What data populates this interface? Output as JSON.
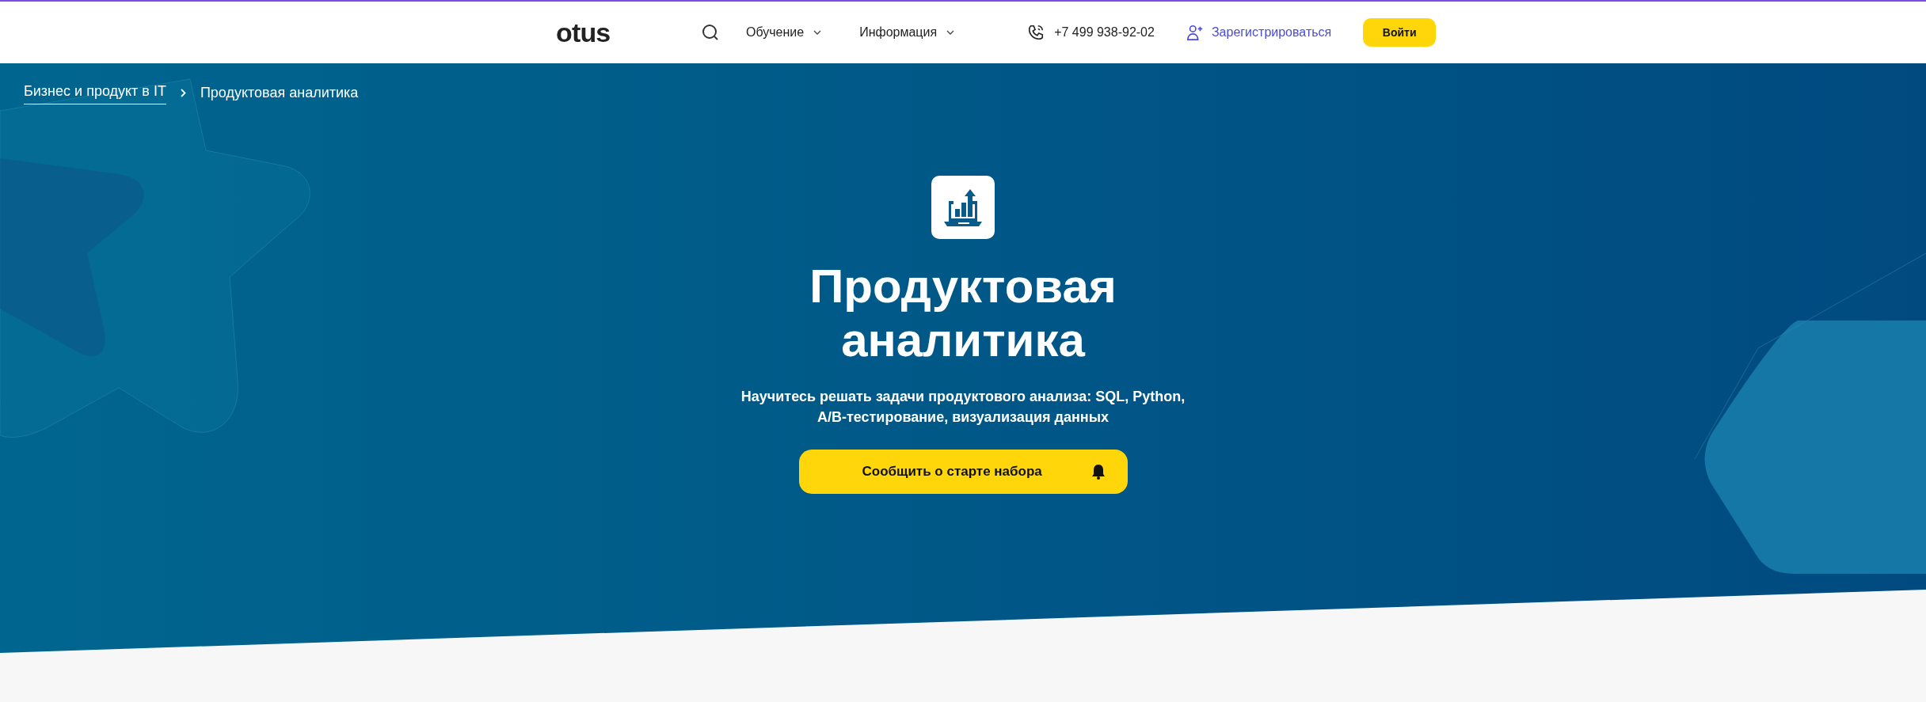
{
  "header": {
    "logo": "otus",
    "nav": [
      {
        "label": "Обучение"
      },
      {
        "label": "Информация"
      }
    ],
    "phone": "+7 499 938-92-02",
    "register": "Зарегистрироваться",
    "login": "Войти"
  },
  "breadcrumbs": [
    {
      "label": "Бизнес и продукт в IT",
      "link": true
    },
    {
      "label": "Продуктовая аналитика",
      "link": false
    }
  ],
  "hero": {
    "title_lines": [
      "Продуктовая",
      "аналитика"
    ],
    "subtitle_lines": [
      "Научитесь решать задачи продуктового анализа: SQL, Python,",
      "A/B-тестирование, визуализация данных"
    ],
    "button": "Сообщить о старте набора"
  }
}
